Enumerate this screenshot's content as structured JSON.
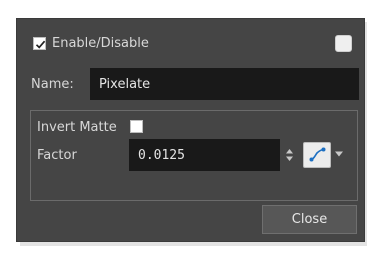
{
  "dialog": {
    "enable": {
      "label": "Enable/Disable",
      "checked": true
    },
    "name": {
      "label": "Name:",
      "value": "Pixelate"
    },
    "invert_matte": {
      "label": "Invert Matte",
      "checked": false
    },
    "factor": {
      "label": "Factor",
      "value": "0.0125"
    },
    "close_label": "Close"
  },
  "icons": {
    "checkmark": "checkmark-icon",
    "spinner": "spin-up-down-icon",
    "function_curve": "function-curve-icon",
    "dropdown": "chevron-down-icon"
  },
  "colors": {
    "panel": "#454545",
    "field": "#191919",
    "text": "#d8d8d8",
    "accent": "#1c6fc2"
  }
}
